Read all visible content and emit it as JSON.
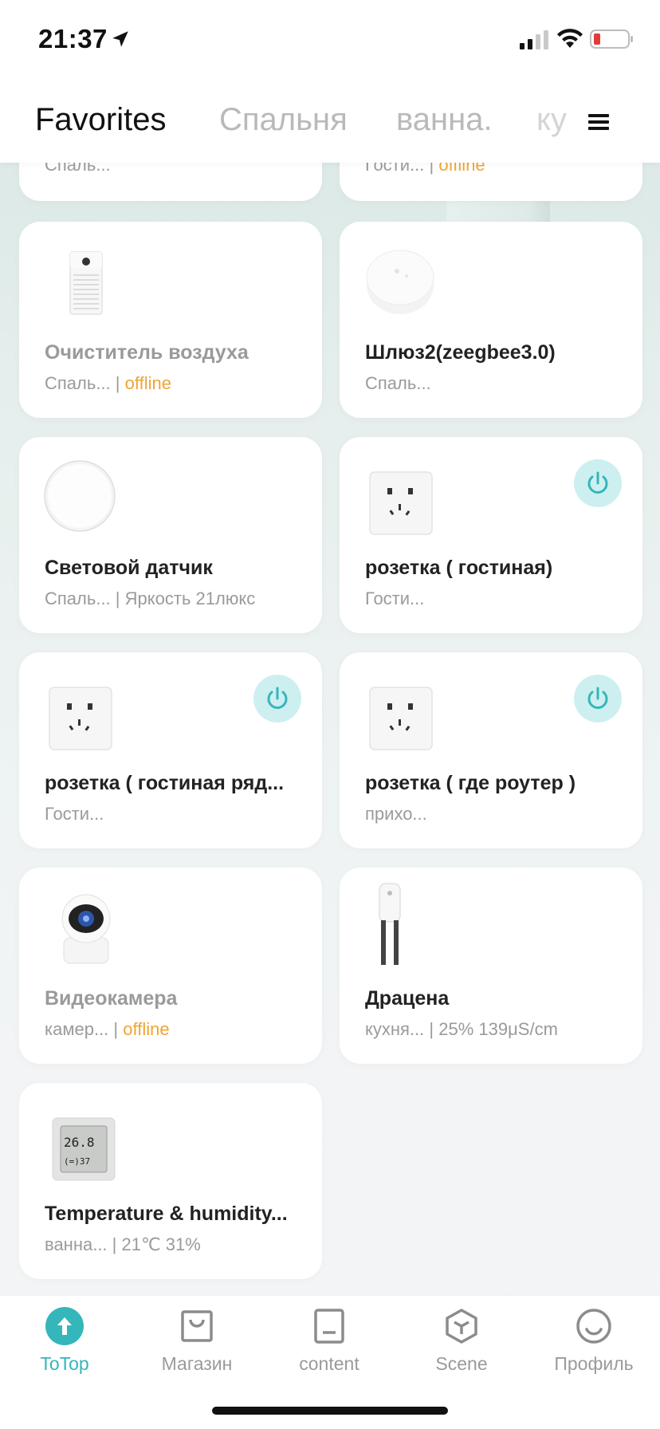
{
  "status_bar": {
    "time": "21:37"
  },
  "header": {
    "tabs": [
      {
        "label": "Favorites"
      },
      {
        "label": "Спальня"
      },
      {
        "label": "ванна."
      },
      {
        "label": "ку"
      }
    ]
  },
  "partial_cards": [
    {
      "room": "Спаль...",
      "state": ""
    },
    {
      "room": "Гости...",
      "state": "offline"
    }
  ],
  "devices": [
    {
      "name": "Очиститель воздуха",
      "room": "Спаль...",
      "state": "offline",
      "icon": "air-purifier-icon",
      "dim": true
    },
    {
      "name": "Шлюз2(zeegbee3.0)",
      "room": "Спаль...",
      "state": "",
      "icon": "gateway-icon"
    },
    {
      "name": "Световой датчик",
      "room": "Спаль...",
      "state": "Яркость 21люкс",
      "icon": "light-sensor-icon"
    },
    {
      "name": "розетка ( гостиная)",
      "room": "Гости...",
      "state": "",
      "icon": "socket-icon",
      "power": true
    },
    {
      "name": "розетка ( гостиная ряд...",
      "room": "Гости...",
      "state": "",
      "icon": "socket-icon",
      "power": true
    },
    {
      "name": "розетка ( где роутер )",
      "room": "прихо...",
      "state": "",
      "icon": "socket-icon",
      "power": true
    },
    {
      "name": "Видеокамера",
      "room": "камер...",
      "state": "offline",
      "icon": "camera-icon",
      "dim": true
    },
    {
      "name": "Драцена",
      "room": "кухня...",
      "state": "25% 139μS/cm",
      "icon": "plant-sensor-icon"
    },
    {
      "name": "Temperature & humidity...",
      "room": "ванна...",
      "state": "21℃ 31%",
      "icon": "thermometer-icon"
    }
  ],
  "bottom_nav": [
    {
      "label": "ToTop",
      "icon": "arrow-up-icon"
    },
    {
      "label": "Магазин",
      "icon": "shopping-bag-icon"
    },
    {
      "label": "content",
      "icon": "content-icon"
    },
    {
      "label": "Scene",
      "icon": "cube-icon"
    },
    {
      "label": "Профиль",
      "icon": "smiley-icon"
    }
  ],
  "sep": "|",
  "colors": {
    "accent": "#35b6ba",
    "offline": "#f0a433",
    "power_bg": "#cdeff0"
  }
}
